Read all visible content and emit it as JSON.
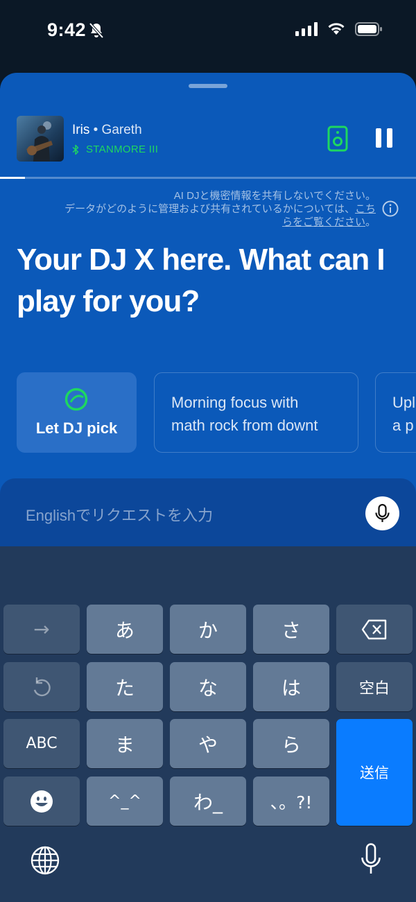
{
  "status_bar": {
    "time": "9:42"
  },
  "now_playing": {
    "track": "Iris",
    "separator": " • ",
    "artist": "Gareth",
    "device": "STANMORE III",
    "progress_percent": 6
  },
  "privacy_notice": {
    "line1": "AI DJと機密情報を共有しないでください。",
    "line2_prefix": "データがどのように管理および共有されているかについては、",
    "link_text_a": "こち",
    "link_text_b": "らをご覧ください",
    "line3_suffix": "。"
  },
  "headline": "Your DJ X here. What can I play for you?",
  "suggestions": {
    "dj_pick_label": "Let DJ pick",
    "chip2_text": "Morning focus with\nmath rock from downt",
    "chip3_text": "Upl\na p"
  },
  "input": {
    "placeholder": "Englishでリクエストを入力"
  },
  "keyboard": {
    "row1": [
      "→",
      "あ",
      "か",
      "さ",
      "⌫"
    ],
    "row2": [
      "↺",
      "た",
      "な",
      "は",
      "空白"
    ],
    "row3": [
      "ABC",
      "ま",
      "や",
      "ら"
    ],
    "row4": [
      "☻",
      "^_^",
      "わ_",
      "、。?!"
    ],
    "send": "送信"
  },
  "colors": {
    "sheet_bg": "#0b59b9",
    "accent_green": "#1ed760",
    "send_key": "#0a7cff"
  }
}
